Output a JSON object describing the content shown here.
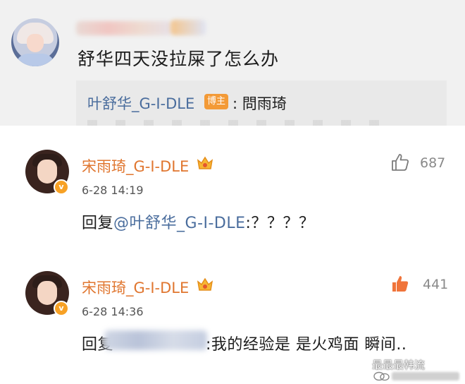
{
  "post": {
    "text": "舒华四天没拉屎了怎么办",
    "quote": {
      "author": "叶舒华_G-I-DLE",
      "badge": "博主",
      "text": ": 問雨琦"
    }
  },
  "comments": [
    {
      "username": "宋雨琦_G-I-DLE",
      "timestamp": "6-28 14:19",
      "likes": "687",
      "liked": false,
      "reply_prefix": "回复",
      "mention": "@叶舒华_G-I-DLE",
      "text": ":？？？？"
    },
    {
      "username": "宋雨琦_G-I-DLE",
      "timestamp": "6-28 14:36",
      "likes": "441",
      "liked": true,
      "reply_prefix": "回复",
      "text": ":我的经验是 是火鸡面 瞬间.."
    }
  ],
  "colors": {
    "username": "#e0762f",
    "mention": "#4a6d9d",
    "liked_thumb": "#f0743a",
    "badge_bg": "#f39a37"
  },
  "verified_badge": "v",
  "watermark": {
    "text": "最最最韩流"
  },
  "icons": [
    "thumb-up-icon",
    "crown-badge-icon",
    "verified-badge-icon",
    "wechat-icon"
  ]
}
